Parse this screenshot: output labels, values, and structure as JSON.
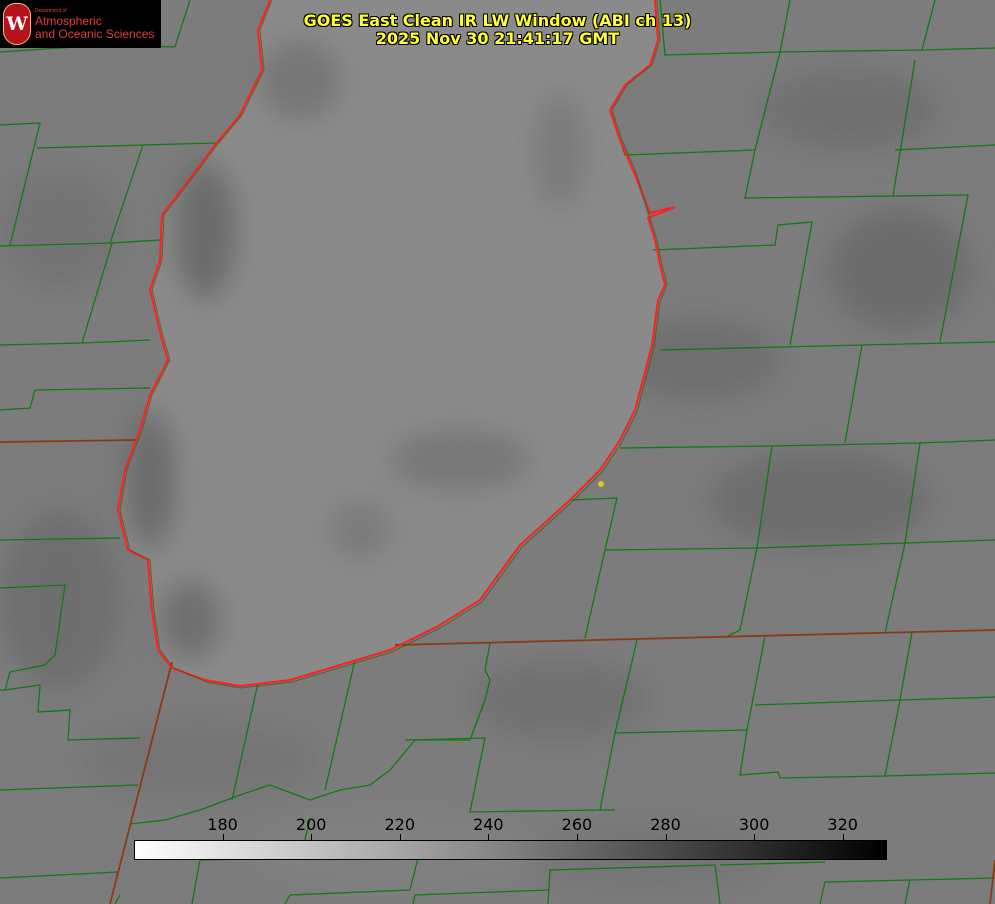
{
  "title": {
    "line1": "GOES East Clean IR LW Window (ABI ch 13)",
    "line2": "2025 Nov 30 21:41:17 GMT"
  },
  "logo": {
    "dept": "Department of",
    "line1": "Atmospheric",
    "line2": "and Oceanic Sciences",
    "seal_letter": "W"
  },
  "colors": {
    "county_lines": "#127a12",
    "state_lines": "#8a3a16",
    "lake_outline": "#ff2020",
    "title_text": "#ffff33",
    "marker": "#d8cc20"
  },
  "colorbar": {
    "min": 160,
    "max": 330,
    "ticks": [
      "180",
      "200",
      "220",
      "240",
      "260",
      "280",
      "300",
      "320"
    ],
    "gradient": "white to black"
  }
}
